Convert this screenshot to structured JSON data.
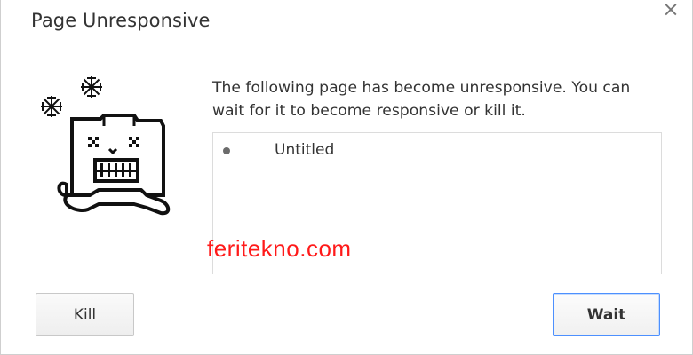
{
  "dialog": {
    "title": "Page Unresponsive",
    "close_icon": "close-icon",
    "close_glyph": "×",
    "message": "The following page has become unresponsive. You can wait for it to become responsive or kill it.",
    "pages": [
      {
        "label": "Untitled"
      }
    ],
    "buttons": {
      "kill_label": "Kill",
      "wait_label": "Wait"
    }
  },
  "mascot": {
    "icon": "frozen-tab-mascot-icon"
  },
  "watermark": {
    "text": "feritekno.com",
    "color": "#ff1a1a"
  },
  "colors": {
    "accent_border": "#4d90fe"
  }
}
